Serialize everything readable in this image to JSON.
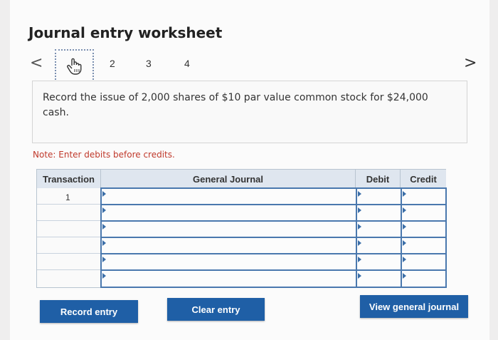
{
  "title": "Journal entry worksheet",
  "nav": {
    "prev": "<",
    "next": ">"
  },
  "steps": [
    "2",
    "3",
    "4"
  ],
  "prompt": "Record the issue of 2,000 shares of $10 par value common stock for $24,000 cash.",
  "note": "Note: Enter debits before credits.",
  "table": {
    "headers": {
      "transaction": "Transaction",
      "journal": "General Journal",
      "debit": "Debit",
      "credit": "Credit"
    },
    "rows": [
      {
        "transaction": "1",
        "account": "",
        "debit": "",
        "credit": ""
      },
      {
        "transaction": "",
        "account": "",
        "debit": "",
        "credit": ""
      },
      {
        "transaction": "",
        "account": "",
        "debit": "",
        "credit": ""
      },
      {
        "transaction": "",
        "account": "",
        "debit": "",
        "credit": ""
      },
      {
        "transaction": "",
        "account": "",
        "debit": "",
        "credit": ""
      },
      {
        "transaction": "",
        "account": "",
        "debit": "",
        "credit": ""
      }
    ]
  },
  "buttons": {
    "record": "Record entry",
    "clear": "Clear entry",
    "view": "View general journal"
  },
  "colors": {
    "button": "#1f5fa6",
    "note": "#c0392b",
    "header_bg": "#dfe6ef",
    "input_border": "#4a78ae"
  },
  "icons": {
    "current_step": "hand-pointer-icon"
  }
}
